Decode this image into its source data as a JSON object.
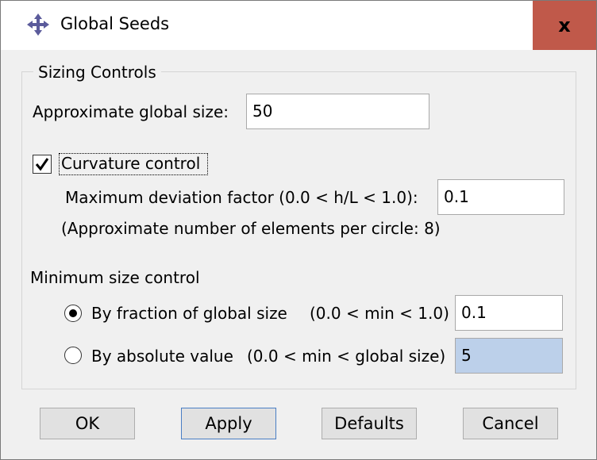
{
  "window": {
    "title": "Global Seeds",
    "close_label": "x"
  },
  "sizing": {
    "group_title": "Sizing Controls",
    "global_size_label": "Approximate global size:",
    "global_size_value": "50",
    "curvature_label": "Curvature control",
    "curvature_checked": true,
    "deviation_label": "Maximum deviation factor (0.0 < h/L < 1.0):",
    "deviation_value": "0.1",
    "elements_note": "(Approximate number of elements per circle: 8)"
  },
  "min_size": {
    "label": "Minimum size control",
    "fraction_label": "By fraction of global size",
    "fraction_range": "(0.0 < min < 1.0)",
    "fraction_value": "0.1",
    "fraction_selected": true,
    "absolute_label": "By absolute value",
    "absolute_range": "(0.0 < min < global size)",
    "absolute_value": "5",
    "absolute_selected": false
  },
  "buttons": {
    "ok": "OK",
    "apply": "Apply",
    "defaults": "Defaults",
    "cancel": "Cancel"
  },
  "colors": {
    "close_bg": "#c0594a",
    "selected_field": "#bcd0ea",
    "icon": "#5b5b9b"
  }
}
